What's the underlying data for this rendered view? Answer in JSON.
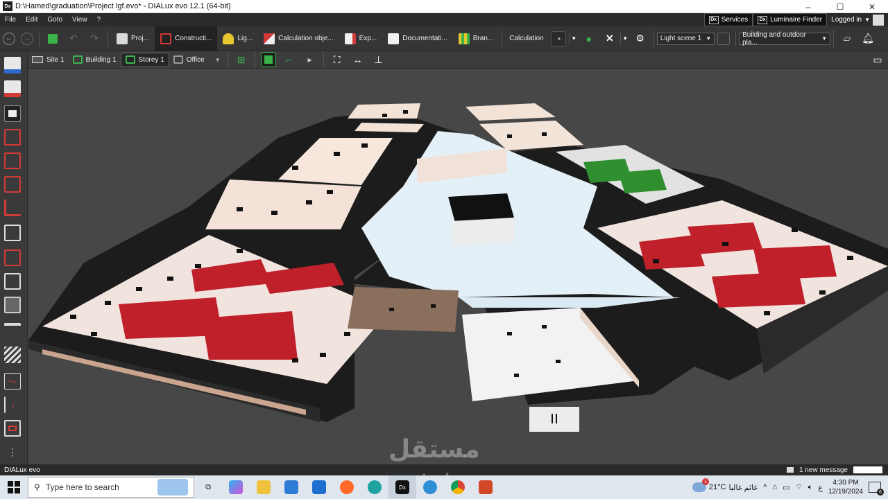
{
  "window": {
    "title": "D:\\Hamed\\graduation\\Project lgf.evo* - DIALux evo 12.1  (64-bit)",
    "icon": "Dx",
    "minimize": "–",
    "maximize": "☐",
    "close": "✕"
  },
  "menu": {
    "items": [
      "File",
      "Edit",
      "Goto",
      "View",
      "?"
    ],
    "services": "Services",
    "luminaire_finder": "Luminaire Finder",
    "logged_in": "Logged in"
  },
  "toolbar": {
    "tabs": [
      {
        "label": "Proj...",
        "color": "#d9d9d9"
      },
      {
        "label": "Constructi...",
        "color": "#d23a3a"
      },
      {
        "label": "Lig...",
        "color": "#e6c82e"
      },
      {
        "label": "Calculation obje...",
        "color": "#d23a3a"
      },
      {
        "label": "Exp...",
        "color": "#f0f0f0"
      },
      {
        "label": "Documentati...",
        "color": "#f0f0f0"
      },
      {
        "label": "Bran...",
        "color": "#e6c82e"
      }
    ],
    "calculation_label": "Calculation",
    "light_scene": "Light scene 1",
    "plan_select": "Building and outdoor pla..."
  },
  "breadcrumb": {
    "items": [
      "Site 1",
      "Building 1",
      "Storey 1",
      "Office"
    ]
  },
  "status": {
    "app_name": "DIALux evo",
    "new_message": "1 new message"
  },
  "taskbar": {
    "search_placeholder": "Type here to search",
    "weather_temp": "21°C",
    "weather_text": "غائم غالبا",
    "time": "4:30 PM",
    "date": "12/19/2024",
    "notification_count": "1",
    "action_count": "6",
    "lang": "ع"
  },
  "watermark": {
    "text": "مستقل",
    "subtext": "mostaql.com"
  },
  "colors": {
    "accent_green": "#3cb34a",
    "seat_red": "#c0202a",
    "floor_pink": "#f3e6e2",
    "wall_dark": "#1c1c1c"
  }
}
